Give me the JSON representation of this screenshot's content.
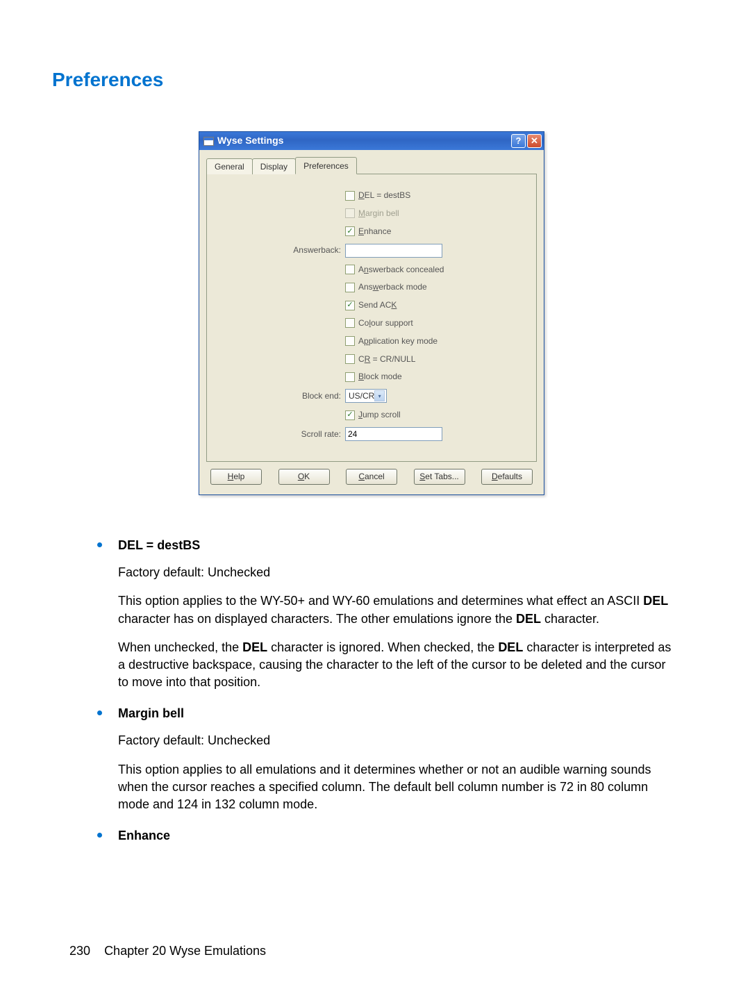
{
  "heading": "Preferences",
  "dialog": {
    "title": "Wyse Settings",
    "tabs": {
      "t0": "General",
      "t1": "Display",
      "t2": "Preferences",
      "active": 2
    },
    "fields": {
      "del": "DEL = destBS",
      "margin": "Margin bell",
      "enhance": "Enhance",
      "answerback_label": "Answerback:",
      "answerback_value": "",
      "ab_conc": "Answerback concealed",
      "ab_mode": "Answerback mode",
      "send_ack": "Send ACK",
      "colour": "Colour support",
      "appkey": "Application key mode",
      "crnull": "CR = CR/NULL",
      "block": "Block mode",
      "blockend_label": "Block end:",
      "blockend_value": "US/CR",
      "jump": "Jump scroll",
      "scroll_label": "Scroll rate:",
      "scroll_value": "24"
    },
    "buttons": {
      "help": "Help",
      "ok": "OK",
      "cancel": "Cancel",
      "settabs": "Set Tabs...",
      "defaults": "Defaults"
    }
  },
  "doc": {
    "items": [
      {
        "title": "DEL = destBS",
        "paras": [
          "Factory default: Unchecked",
          [
            "This option applies to the WY-50+ and WY-60 emulations and determines what effect an ASCII ",
            {
              "b": "DEL"
            },
            " character has on displayed characters. The other emulations ignore the ",
            {
              "b": "DEL"
            },
            " character."
          ],
          [
            "When unchecked, the ",
            {
              "b": "DEL"
            },
            " character is ignored. When checked, the ",
            {
              "b": "DEL"
            },
            " character is interpreted as a destructive backspace, causing the character to the left of the cursor to be deleted and the cursor to move into that position."
          ]
        ]
      },
      {
        "title": "Margin bell",
        "paras": [
          "Factory default: Unchecked",
          "This option applies to all emulations and it determines whether or not an audible warning sounds when the cursor reaches a specified column. The default bell column number is 72 in 80 column mode and 124 in 132 column mode."
        ]
      },
      {
        "title": "Enhance",
        "paras": []
      }
    ]
  },
  "footer": {
    "page": "230",
    "ch": "Chapter 20   Wyse Emulations"
  }
}
